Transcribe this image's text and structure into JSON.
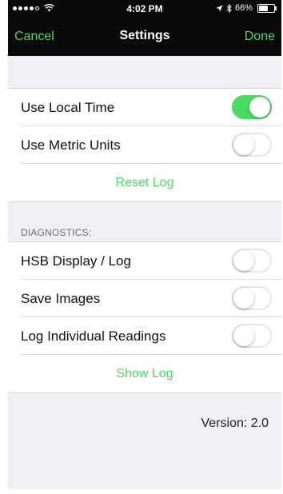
{
  "status_bar": {
    "time": "4:02 PM",
    "battery": "66%",
    "battery_level": 0.66,
    "signal_dots_filled": 4,
    "signal_dots_total": 5
  },
  "nav": {
    "cancel": "Cancel",
    "title": "Settings",
    "done": "Done"
  },
  "settings": {
    "use_local_time": {
      "label": "Use Local Time",
      "on": true
    },
    "use_metric_units": {
      "label": "Use Metric Units",
      "on": false
    },
    "reset_log": "Reset Log"
  },
  "diagnostics": {
    "header": "DIAGNOSTICS:",
    "hsb_display": {
      "label": "HSB Display / Log",
      "on": false
    },
    "save_images": {
      "label": "Save Images",
      "on": false
    },
    "log_readings": {
      "label": "Log Individual Readings",
      "on": false
    },
    "show_log": "Show Log"
  },
  "version": "Version: 2.0",
  "colors": {
    "accent": "#4cd964",
    "nav_background": "#0a0a0a",
    "group_background": "#efeff4"
  },
  "icons": {
    "signal": "signal-dots-icon",
    "wifi": "wifi-icon",
    "location": "location-arrow-icon",
    "bluetooth": "bluetooth-icon",
    "battery": "battery-icon"
  }
}
